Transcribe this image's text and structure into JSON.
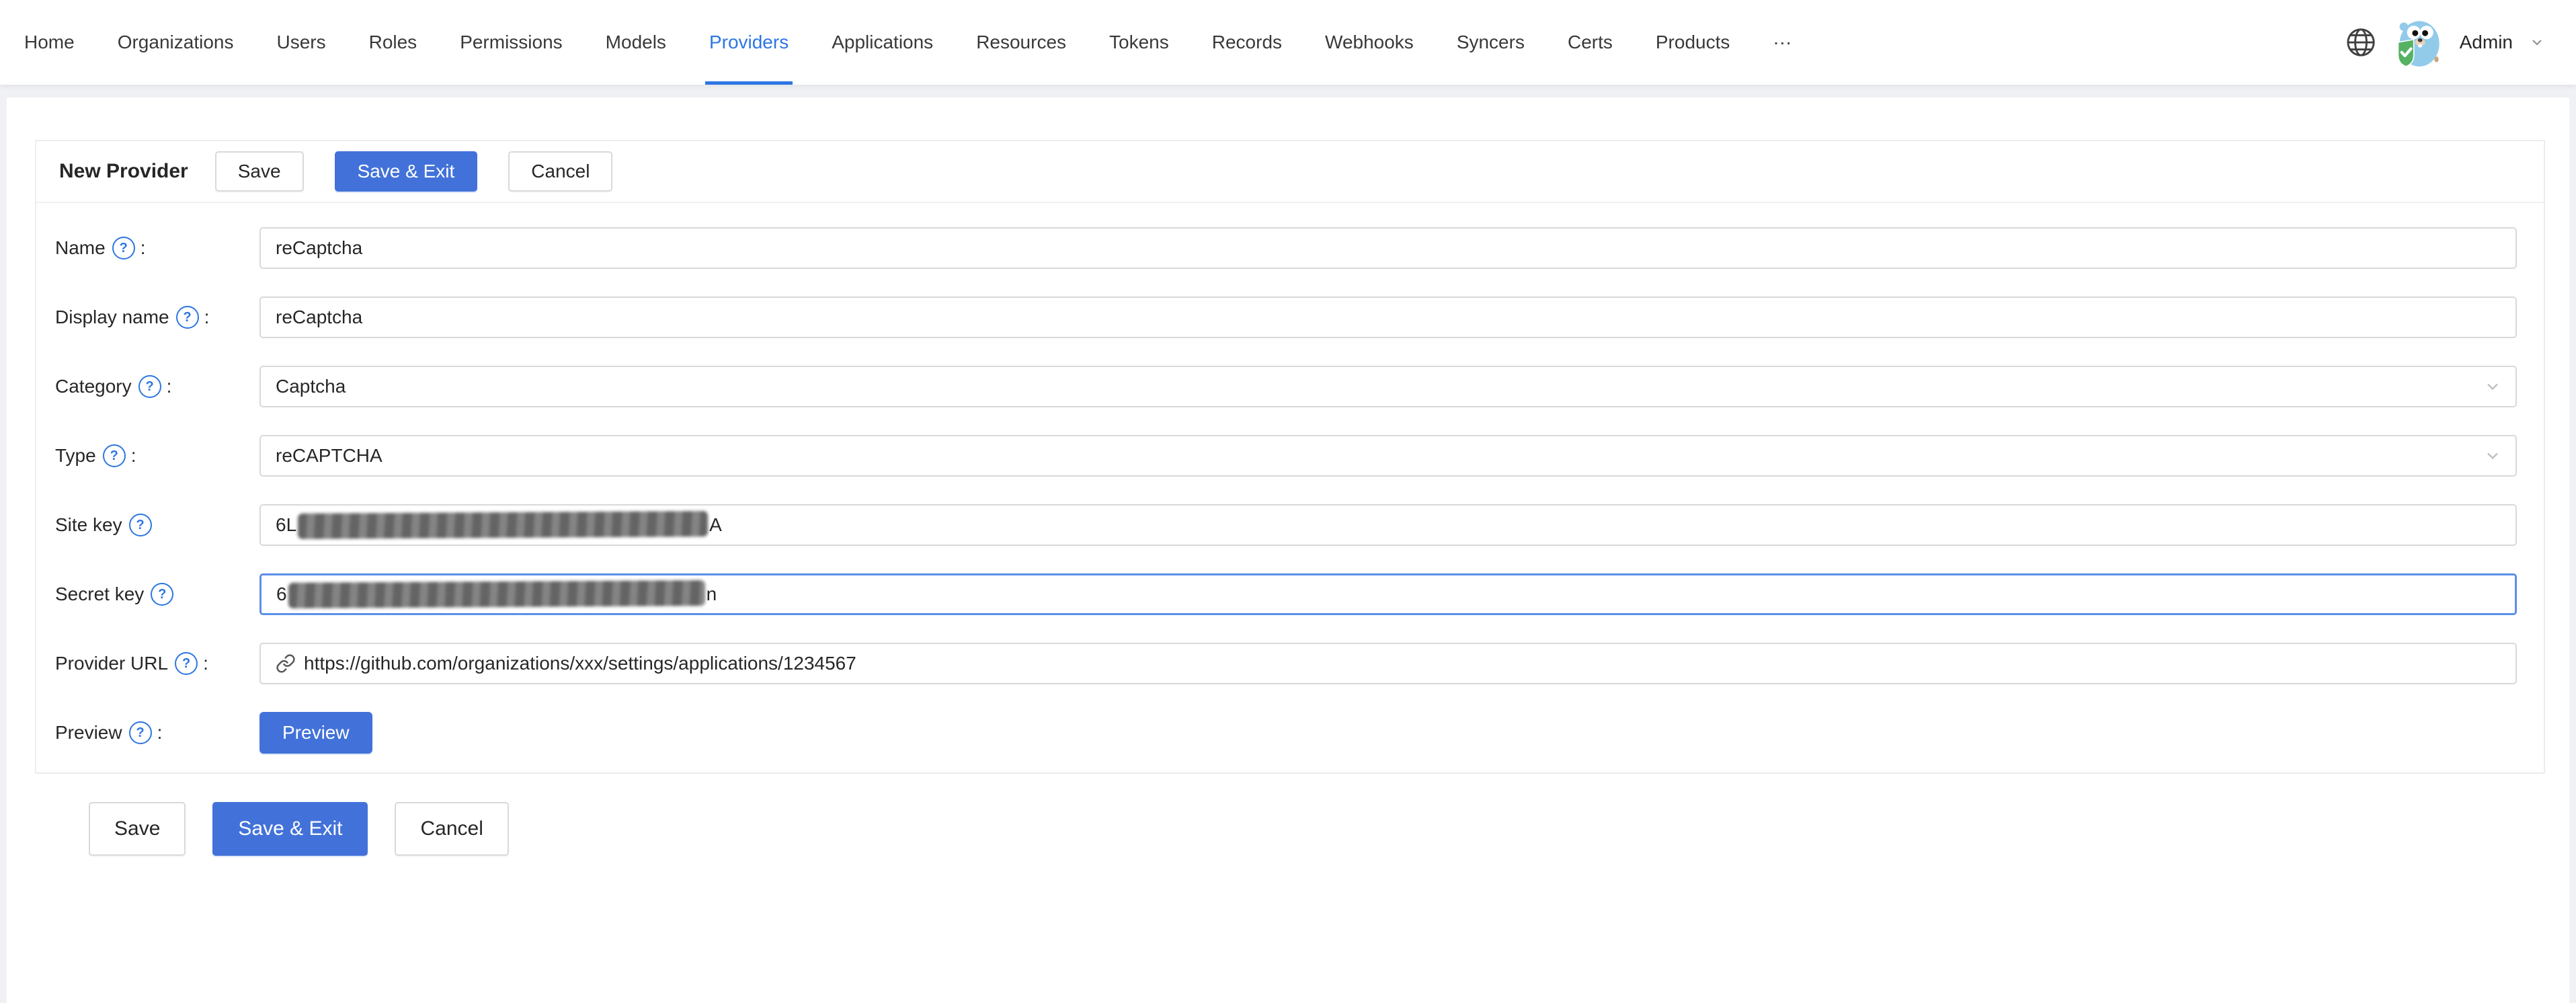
{
  "nav": {
    "items": [
      {
        "label": "Home"
      },
      {
        "label": "Organizations"
      },
      {
        "label": "Users"
      },
      {
        "label": "Roles"
      },
      {
        "label": "Permissions"
      },
      {
        "label": "Models"
      },
      {
        "label": "Providers"
      },
      {
        "label": "Applications"
      },
      {
        "label": "Resources"
      },
      {
        "label": "Tokens"
      },
      {
        "label": "Records"
      },
      {
        "label": "Webhooks"
      },
      {
        "label": "Syncers"
      },
      {
        "label": "Certs"
      },
      {
        "label": "Products"
      },
      {
        "label": "···"
      }
    ],
    "active_item": "Providers",
    "user_name": "Admin"
  },
  "header": {
    "title": "New Provider",
    "save_label": "Save",
    "save_exit_label": "Save & Exit",
    "cancel_label": "Cancel"
  },
  "form": {
    "name": {
      "label": "Name",
      "colon": ":",
      "value": "reCaptcha"
    },
    "display_name": {
      "label": "Display name",
      "colon": ":",
      "value": "reCaptcha"
    },
    "category": {
      "label": "Category",
      "colon": ":",
      "value": "Captcha"
    },
    "type": {
      "label": "Type",
      "colon": ":",
      "value": "reCAPTCHA"
    },
    "site_key": {
      "label": "Site key",
      "value_prefix": "6L",
      "value_suffix": "A",
      "redacted": true
    },
    "secret_key": {
      "label": "Secret key",
      "value_prefix": "6",
      "value_suffix": "n",
      "redacted": true,
      "focused": true
    },
    "provider_url": {
      "label": "Provider URL",
      "colon": ":",
      "value": "https://github.com/organizations/xxx/settings/applications/1234567"
    },
    "preview": {
      "label": "Preview",
      "colon": ":",
      "button_label": "Preview"
    }
  },
  "footer": {
    "save_label": "Save",
    "save_exit_label": "Save & Exit",
    "cancel_label": "Cancel"
  },
  "icons": {
    "help_glyph": "?"
  },
  "colors": {
    "primary": "#4272d9",
    "nav_active": "#2d76e2",
    "focus_border": "#5b8fe8",
    "redaction": "#7a7a7a"
  }
}
